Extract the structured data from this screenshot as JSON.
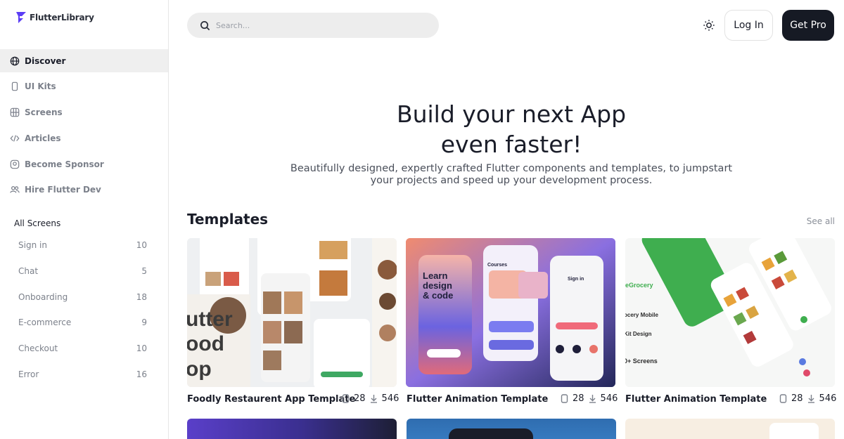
{
  "brand": {
    "name": "FlutterLibrary",
    "accent": "#5b3df5"
  },
  "nav": [
    {
      "label": "Discover",
      "icon": "globe-icon",
      "active": true
    },
    {
      "label": "UI Kits",
      "icon": "phone-icon",
      "active": false
    },
    {
      "label": "Screens",
      "icon": "screens-icon",
      "active": false
    },
    {
      "label": "Articles",
      "icon": "code-icon",
      "active": false
    },
    {
      "label": "Become Sponsor",
      "icon": "sponsor-icon",
      "active": false
    },
    {
      "label": "Hire Flutter Dev",
      "icon": "users-icon",
      "active": false
    }
  ],
  "screens_section": {
    "title": "All Screens",
    "items": [
      {
        "label": "Sign in",
        "count": "10"
      },
      {
        "label": "Chat",
        "count": "5"
      },
      {
        "label": "Onboarding",
        "count": "18"
      },
      {
        "label": "E-commerce",
        "count": "9"
      },
      {
        "label": "Checkout",
        "count": "10"
      },
      {
        "label": "Error",
        "count": "16"
      }
    ]
  },
  "header": {
    "search_placeholder": "Search...",
    "theme_icon": "sun-icon",
    "login_label": "Log In",
    "pro_label": "Get Pro"
  },
  "hero": {
    "title_line1": "Build your next App",
    "title_line2": "even faster!",
    "subtitle_line1": "Beautifully designed, expertly crafted Flutter components and templates, to jumpstart",
    "subtitle_line2": "your projects and speed up your development process."
  },
  "templates": {
    "title": "Templates",
    "see_all": "See all",
    "cards": [
      {
        "name": "Foodly Restaurent App Template",
        "screens": "28",
        "downloads": "546"
      },
      {
        "name": "Flutter Animation Template",
        "screens": "28",
        "downloads": "546",
        "preview_texts": [
          "Learn",
          "design",
          "& code",
          "Courses",
          "Sign in"
        ]
      },
      {
        "name": "Flutter Animation Template",
        "screens": "28",
        "downloads": "546",
        "preview_texts": [
          "eGrocery",
          "ocery Mobile",
          "Kit Design",
          "0+ Screens"
        ]
      }
    ]
  },
  "card1_preview": [
    "utter",
    "ood",
    "op"
  ]
}
